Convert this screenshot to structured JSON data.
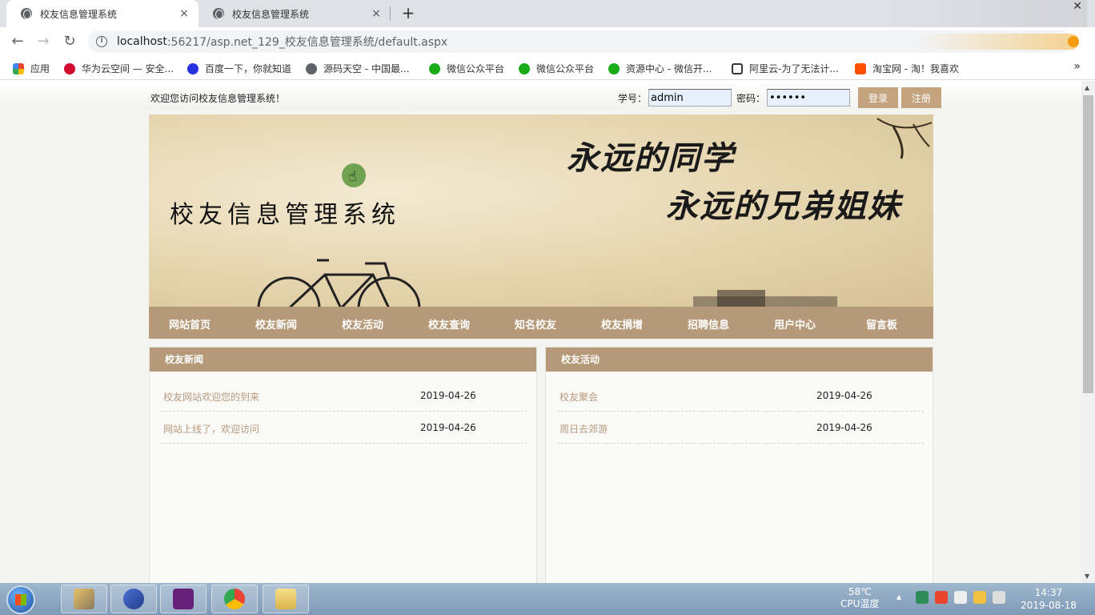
{
  "browser": {
    "tabs": [
      {
        "title": "校友信息管理系统",
        "close": "×"
      },
      {
        "title": "校友信息管理系统",
        "close": "×"
      }
    ],
    "new_tab": "+",
    "url_host": "localhost",
    "url_rest": ":56217/asp.net_129_校友信息管理系统/default.aspx",
    "bookmarks": [
      {
        "label": "应用",
        "icon": "apps-icon",
        "color": "#e94235"
      },
      {
        "label": "华为云空间 — 安全...",
        "icon": "huawei-icon",
        "color": "#cf0a2c"
      },
      {
        "label": "百度一下，你就知道",
        "icon": "baidu-icon",
        "color": "#2932e1"
      },
      {
        "label": "源码天空 - 中国最...",
        "icon": "globe-icon",
        "color": "#5f6368"
      },
      {
        "label": "微信公众平台",
        "icon": "wechat-icon",
        "color": "#1aad19"
      },
      {
        "label": "微信公众平台",
        "icon": "wechat-icon",
        "color": "#1aad19"
      },
      {
        "label": "资源中心 - 微信开...",
        "icon": "wechat-icon",
        "color": "#1aad19"
      },
      {
        "label": "阿里云-为了无法计...",
        "icon": "aliyun-icon",
        "color": "#333333"
      },
      {
        "label": "淘宝网 - 淘！我喜欢",
        "icon": "taobao-icon",
        "color": "#ff5000"
      }
    ],
    "more": "»"
  },
  "header": {
    "welcome": "欢迎您访问校友信息管理系统！",
    "student_id_label": "学号：",
    "student_id_value": "admin",
    "password_label": "密码：",
    "password_value": "123456",
    "login_button": "登录",
    "register_button": "注册"
  },
  "banner": {
    "site_title": "校友信息管理系统",
    "slogan1": "永远的同学",
    "slogan2": "永远的兄弟姐妹"
  },
  "nav": [
    "网站首页",
    "校友新闻",
    "校友活动",
    "校友查询",
    "知名校友",
    "校友捐增",
    "招聘信息",
    "用户中心",
    "留言板"
  ],
  "panels": {
    "news": {
      "title": "校友新闻",
      "items": [
        {
          "title": "校友网站欢迎您的到来",
          "date": "2019-04-26"
        },
        {
          "title": "网站上线了，欢迎访问",
          "date": "2019-04-26"
        }
      ]
    },
    "activities": {
      "title": "校友活动",
      "items": [
        {
          "title": "校友聚会",
          "date": "2019-04-26"
        },
        {
          "title": "周日去郊游",
          "date": "2019-04-26"
        }
      ]
    }
  },
  "taskbar": {
    "temp": "58℃",
    "temp_label": "CPU温度",
    "time": "14:37",
    "date": "2019-08-18"
  },
  "colors": {
    "accent": "#b69978",
    "button": "#c4a47e",
    "link": "#b89a7a"
  }
}
